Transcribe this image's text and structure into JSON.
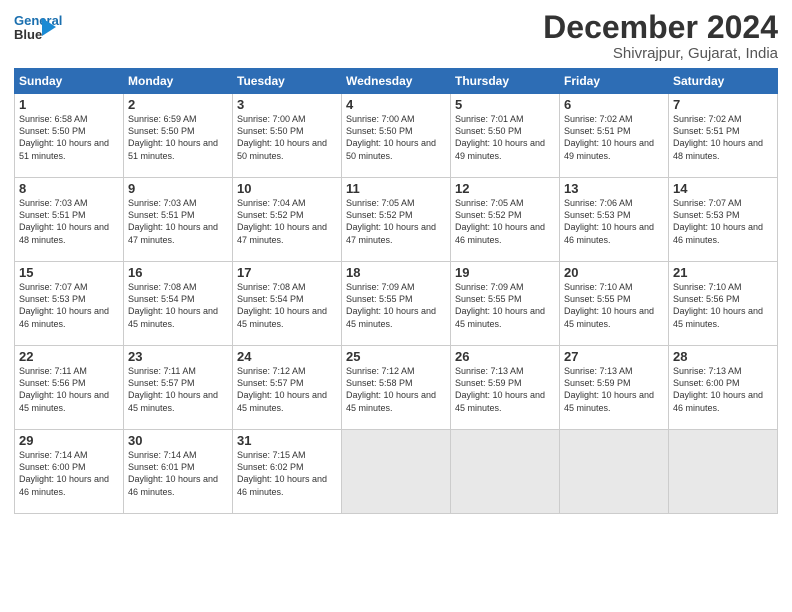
{
  "logo": {
    "line1": "General",
    "line2": "Blue"
  },
  "title": "December 2024",
  "location": "Shivrajpur, Gujarat, India",
  "days_of_week": [
    "Sunday",
    "Monday",
    "Tuesday",
    "Wednesday",
    "Thursday",
    "Friday",
    "Saturday"
  ],
  "weeks": [
    [
      {
        "day": "1",
        "sunrise": "6:58 AM",
        "sunset": "5:50 PM",
        "daylight": "10 hours and 51 minutes.",
        "shaded": false
      },
      {
        "day": "2",
        "sunrise": "6:59 AM",
        "sunset": "5:50 PM",
        "daylight": "10 hours and 51 minutes.",
        "shaded": false
      },
      {
        "day": "3",
        "sunrise": "7:00 AM",
        "sunset": "5:50 PM",
        "daylight": "10 hours and 50 minutes.",
        "shaded": false
      },
      {
        "day": "4",
        "sunrise": "7:00 AM",
        "sunset": "5:50 PM",
        "daylight": "10 hours and 50 minutes.",
        "shaded": false
      },
      {
        "day": "5",
        "sunrise": "7:01 AM",
        "sunset": "5:50 PM",
        "daylight": "10 hours and 49 minutes.",
        "shaded": false
      },
      {
        "day": "6",
        "sunrise": "7:02 AM",
        "sunset": "5:51 PM",
        "daylight": "10 hours and 49 minutes.",
        "shaded": false
      },
      {
        "day": "7",
        "sunrise": "7:02 AM",
        "sunset": "5:51 PM",
        "daylight": "10 hours and 48 minutes.",
        "shaded": false
      }
    ],
    [
      {
        "day": "8",
        "sunrise": "7:03 AM",
        "sunset": "5:51 PM",
        "daylight": "10 hours and 48 minutes.",
        "shaded": false
      },
      {
        "day": "9",
        "sunrise": "7:03 AM",
        "sunset": "5:51 PM",
        "daylight": "10 hours and 47 minutes.",
        "shaded": false
      },
      {
        "day": "10",
        "sunrise": "7:04 AM",
        "sunset": "5:52 PM",
        "daylight": "10 hours and 47 minutes.",
        "shaded": false
      },
      {
        "day": "11",
        "sunrise": "7:05 AM",
        "sunset": "5:52 PM",
        "daylight": "10 hours and 47 minutes.",
        "shaded": false
      },
      {
        "day": "12",
        "sunrise": "7:05 AM",
        "sunset": "5:52 PM",
        "daylight": "10 hours and 46 minutes.",
        "shaded": false
      },
      {
        "day": "13",
        "sunrise": "7:06 AM",
        "sunset": "5:53 PM",
        "daylight": "10 hours and 46 minutes.",
        "shaded": false
      },
      {
        "day": "14",
        "sunrise": "7:07 AM",
        "sunset": "5:53 PM",
        "daylight": "10 hours and 46 minutes.",
        "shaded": false
      }
    ],
    [
      {
        "day": "15",
        "sunrise": "7:07 AM",
        "sunset": "5:53 PM",
        "daylight": "10 hours and 46 minutes.",
        "shaded": false
      },
      {
        "day": "16",
        "sunrise": "7:08 AM",
        "sunset": "5:54 PM",
        "daylight": "10 hours and 45 minutes.",
        "shaded": false
      },
      {
        "day": "17",
        "sunrise": "7:08 AM",
        "sunset": "5:54 PM",
        "daylight": "10 hours and 45 minutes.",
        "shaded": false
      },
      {
        "day": "18",
        "sunrise": "7:09 AM",
        "sunset": "5:55 PM",
        "daylight": "10 hours and 45 minutes.",
        "shaded": false
      },
      {
        "day": "19",
        "sunrise": "7:09 AM",
        "sunset": "5:55 PM",
        "daylight": "10 hours and 45 minutes.",
        "shaded": false
      },
      {
        "day": "20",
        "sunrise": "7:10 AM",
        "sunset": "5:55 PM",
        "daylight": "10 hours and 45 minutes.",
        "shaded": false
      },
      {
        "day": "21",
        "sunrise": "7:10 AM",
        "sunset": "5:56 PM",
        "daylight": "10 hours and 45 minutes.",
        "shaded": false
      }
    ],
    [
      {
        "day": "22",
        "sunrise": "7:11 AM",
        "sunset": "5:56 PM",
        "daylight": "10 hours and 45 minutes.",
        "shaded": false
      },
      {
        "day": "23",
        "sunrise": "7:11 AM",
        "sunset": "5:57 PM",
        "daylight": "10 hours and 45 minutes.",
        "shaded": false
      },
      {
        "day": "24",
        "sunrise": "7:12 AM",
        "sunset": "5:57 PM",
        "daylight": "10 hours and 45 minutes.",
        "shaded": false
      },
      {
        "day": "25",
        "sunrise": "7:12 AM",
        "sunset": "5:58 PM",
        "daylight": "10 hours and 45 minutes.",
        "shaded": false
      },
      {
        "day": "26",
        "sunrise": "7:13 AM",
        "sunset": "5:59 PM",
        "daylight": "10 hours and 45 minutes.",
        "shaded": false
      },
      {
        "day": "27",
        "sunrise": "7:13 AM",
        "sunset": "5:59 PM",
        "daylight": "10 hours and 45 minutes.",
        "shaded": false
      },
      {
        "day": "28",
        "sunrise": "7:13 AM",
        "sunset": "6:00 PM",
        "daylight": "10 hours and 46 minutes.",
        "shaded": false
      }
    ],
    [
      {
        "day": "29",
        "sunrise": "7:14 AM",
        "sunset": "6:00 PM",
        "daylight": "10 hours and 46 minutes.",
        "shaded": false
      },
      {
        "day": "30",
        "sunrise": "7:14 AM",
        "sunset": "6:01 PM",
        "daylight": "10 hours and 46 minutes.",
        "shaded": false
      },
      {
        "day": "31",
        "sunrise": "7:15 AM",
        "sunset": "6:02 PM",
        "daylight": "10 hours and 46 minutes.",
        "shaded": false
      },
      {
        "day": "",
        "sunrise": "",
        "sunset": "",
        "daylight": "",
        "shaded": true
      },
      {
        "day": "",
        "sunrise": "",
        "sunset": "",
        "daylight": "",
        "shaded": true
      },
      {
        "day": "",
        "sunrise": "",
        "sunset": "",
        "daylight": "",
        "shaded": true
      },
      {
        "day": "",
        "sunrise": "",
        "sunset": "",
        "daylight": "",
        "shaded": true
      }
    ]
  ]
}
